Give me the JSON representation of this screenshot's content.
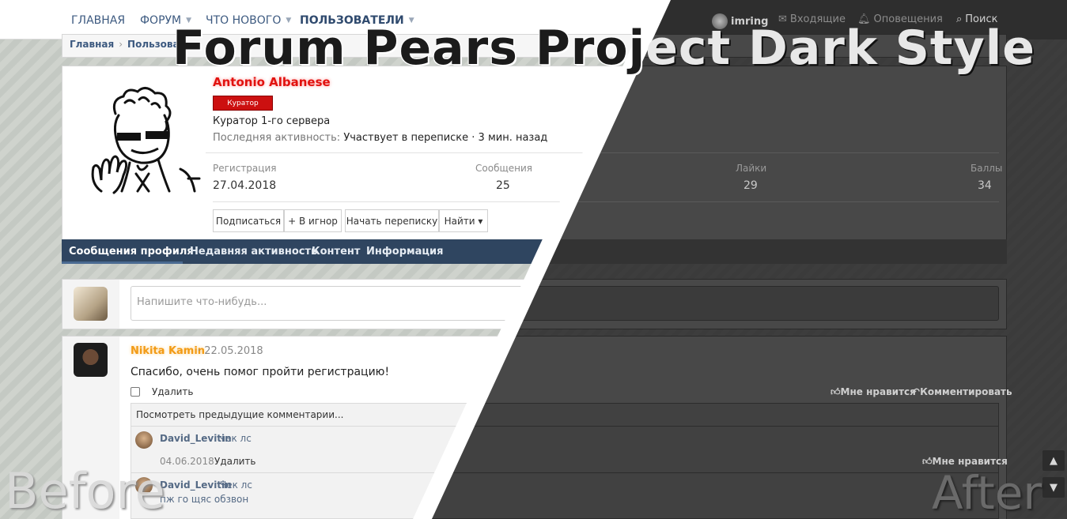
{
  "headline": {
    "dark_part": "Forum Pears Proj",
    "light_part": "ect Dark Style"
  },
  "labels": {
    "before": "Before",
    "after": "After"
  },
  "nav": {
    "home": "ГЛАВНАЯ",
    "forum": "ФОРУМ",
    "whats_new": "ЧТО НОВОГО",
    "users": "ПОЛЬЗОВАТЕЛИ",
    "account_name": "imring",
    "inbox": "Входящие",
    "alerts": "Оповещения",
    "search": "Поиск"
  },
  "breadcrumb": {
    "home": "Главная",
    "users": "Пользовател"
  },
  "profile": {
    "username": "Antonio Albanese",
    "badge": "Куратор",
    "title": "Куратор 1-го сервера",
    "last_activity_label": "Последняя активность:",
    "last_activity_value": "Участвует в переписке · 3 мин. назад",
    "stats": {
      "registration_label": "Регистрация",
      "registration_value": "27.04.2018",
      "messages_label": "Сообщения",
      "messages_value": "25",
      "likes_label": "Лайки",
      "likes_value": "29",
      "points_label": "Баллы",
      "points_value": "34"
    },
    "buttons": {
      "follow": "Подписаться",
      "ignore": "+ В игнор",
      "start_conversation": "Начать переписку",
      "find": "Найти ▾"
    },
    "tabs": [
      "Сообщения профиля",
      "Недавняя активность",
      "Контент",
      "Информация"
    ]
  },
  "composer": {
    "placeholder": "Напишите что-нибудь..."
  },
  "post": {
    "author": "Nikita Kamin",
    "date": "· 22.05.2018",
    "text": "Спасибо, очень помог пройти регистрацию!",
    "delete": "Удалить",
    "like": "Мне нравится",
    "reply": "Комментировать",
    "view_previous": "Посмотреть предыдущие комментарии...",
    "comments": [
      {
        "author": "David_Levitin",
        "text": "чек лс",
        "date": "04.06.2018",
        "delete": "Удалить",
        "like": "Мне нравится"
      },
      {
        "author": "David_Levitin",
        "text": "Чек лс",
        "text2": "пж го щяс обзвон"
      }
    ]
  },
  "colors": {
    "accent": "#2f4560",
    "username": "#e1120f",
    "badge": "#cc1010",
    "post_author": "#f29b16",
    "dark_bg": "#3c3c3c"
  }
}
